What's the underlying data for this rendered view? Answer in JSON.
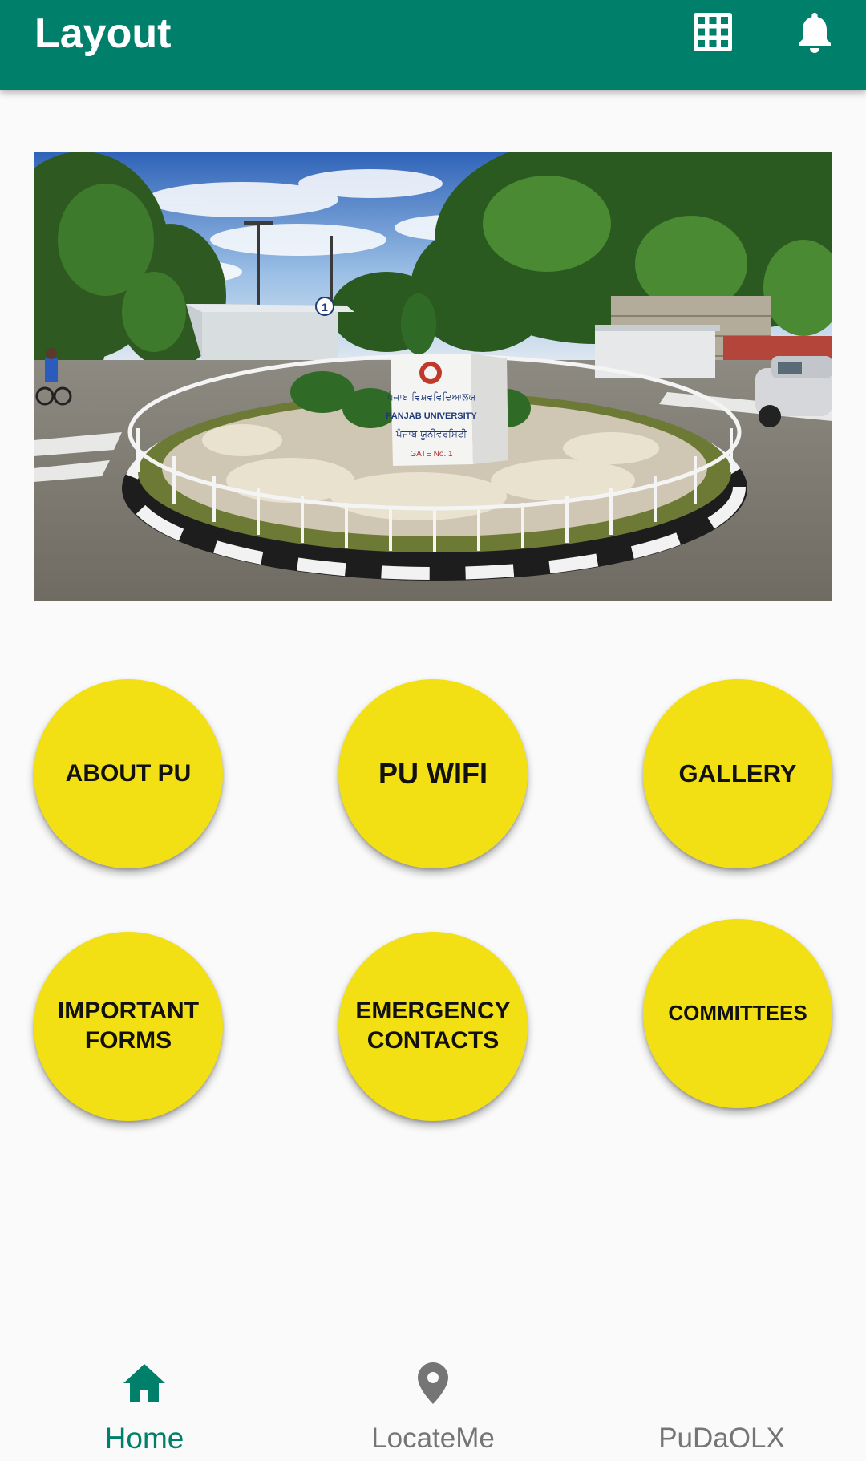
{
  "appbar": {
    "title": "Layout",
    "icons": [
      "grid-icon",
      "bell-icon"
    ]
  },
  "hero": {
    "sign": {
      "line1": "ਪੰਜਾਬ ਵਿਸ਼ਵਵਿਦਿਆਲਯ",
      "line2": "PANJAB UNIVERSITY",
      "line3": "ਪੰਜਾਬ ਯੂਨੀਵਰਸਿਟੀ",
      "line4": "GATE No. 1"
    },
    "gate_number": "1"
  },
  "tiles": [
    {
      "label": "ABOUT PU"
    },
    {
      "label": "PU WIFI"
    },
    {
      "label": "GALLERY"
    },
    {
      "label": "IMPORTANT FORMS"
    },
    {
      "label": "EMERGENCY CONTACTS"
    },
    {
      "label": "COMMITTEES"
    }
  ],
  "bottom_nav": {
    "items": [
      {
        "label": "Home",
        "icon": "home-icon",
        "active": true
      },
      {
        "label": "LocateMe",
        "icon": "location-pin-icon",
        "active": false
      },
      {
        "label": "PuDaOLX",
        "icon": "",
        "active": false
      }
    ]
  },
  "colors": {
    "primary": "#00806b",
    "tile": "#f3e014",
    "inactive_nav": "#757575",
    "background": "#fafafa"
  }
}
